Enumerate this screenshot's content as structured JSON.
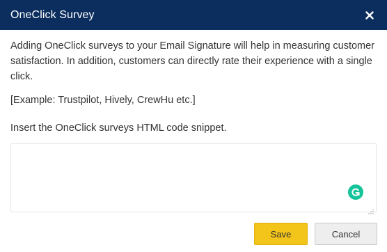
{
  "dialog": {
    "title": "OneClick Survey",
    "close_icon": "close-icon"
  },
  "content": {
    "description": "Adding OneClick surveys to your Email Signature will help in measuring customer satisfaction. In addition, customers can directly rate their experience with a single click.",
    "example": "[Example: Trustpilot, Hively, CrewHu etc.]",
    "instruction": "Insert the OneClick surveys HTML code snippet.",
    "snippet_value": "",
    "grammarly_icon": "grammarly-icon"
  },
  "footer": {
    "save_label": "Save",
    "cancel_label": "Cancel"
  },
  "colors": {
    "header_bg": "#0b2e5e",
    "save_bg": "#f3c419",
    "grammarly": "#15c39a"
  }
}
